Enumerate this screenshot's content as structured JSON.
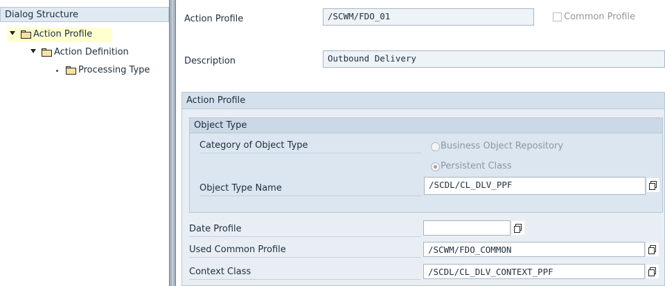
{
  "dialog_structure": {
    "title": "Dialog Structure",
    "items": [
      {
        "label": "Action Profile",
        "level": 0,
        "expanded": true,
        "selected": true
      },
      {
        "label": "Action Definition",
        "level": 1,
        "expanded": true,
        "selected": false
      },
      {
        "label": "Processing Type",
        "level": 2,
        "expanded": false,
        "selected": false
      }
    ]
  },
  "header": {
    "action_profile_label": "Action Profile",
    "action_profile_value": "/SCWM/FDO_01",
    "common_profile_label": "Common Profile",
    "common_profile_checked": false,
    "description_label": "Description",
    "description_value": "Outbound Delivery"
  },
  "action_profile_group": {
    "title": "Action Profile",
    "object_type": {
      "title": "Object Type",
      "category_label": "Category of Object Type",
      "options": [
        {
          "label": "Business Object Repository",
          "selected": false
        },
        {
          "label": "Persistent Class",
          "selected": true
        }
      ],
      "object_type_name_label": "Object Type Name",
      "object_type_name_value": "/SCDL/CL_DLV_PPF"
    },
    "date_profile_label": "Date Profile",
    "date_profile_value": "",
    "used_common_profile_label": "Used Common Profile",
    "used_common_profile_value": "/SCWM/FDO_COMMON",
    "context_class_label": "Context Class",
    "context_class_value": "/SCDL/CL_DLV_CONTEXT_PPF"
  },
  "colors": {
    "selected_row": "#ffffd0",
    "group_bg": "#e8eef4",
    "header_bg": "#dfe9f2"
  }
}
